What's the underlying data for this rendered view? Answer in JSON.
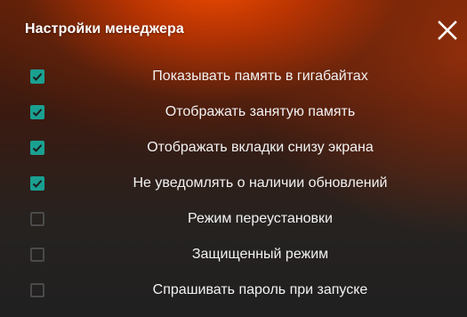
{
  "dialog": {
    "title": "Настройки менеджера",
    "close_icon": "close-icon",
    "accent_color": "#1aa091"
  },
  "options": [
    {
      "label": "Показывать память в гигабайтах",
      "checked": true
    },
    {
      "label": "Отображать занятую память",
      "checked": true
    },
    {
      "label": "Отображать вкладки снизу экрана",
      "checked": true
    },
    {
      "label": "Не уведомлять о наличии обновлений",
      "checked": true
    },
    {
      "label": "Режим переустановки",
      "checked": false
    },
    {
      "label": "Защищенный режим",
      "checked": false
    },
    {
      "label": "Спрашивать пароль при запуске",
      "checked": false
    }
  ]
}
